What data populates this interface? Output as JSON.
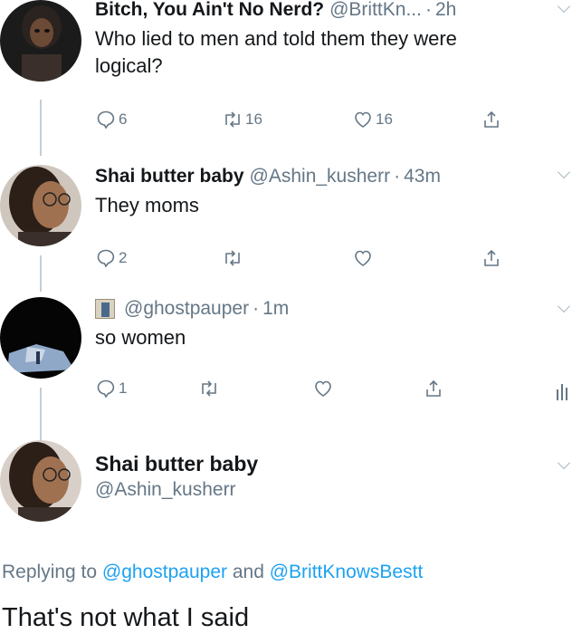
{
  "tweet1": {
    "name": "Bitch, You Ain't No Nerd?",
    "handle": "@BrittKn...",
    "sep": "·",
    "time": "2h",
    "text_line1": "Who lied to men and told them they were",
    "text_line2": "logical?",
    "replies": "6",
    "retweets": "16",
    "likes": "16"
  },
  "tweet2": {
    "name": "Shai butter baby",
    "handle": "@Ashin_kusherr",
    "sep": "·",
    "time": "43m",
    "text": "They moms",
    "replies": "2"
  },
  "tweet3": {
    "handle": "@ghostpauper",
    "sep": "·",
    "time": "1m",
    "text": "so women",
    "replies": "1"
  },
  "tweet4": {
    "name": "Shai butter baby",
    "handle": "@Ashin_kusherr",
    "replying_prefix": "Replying to",
    "reply_user1": "@ghostpauper",
    "reply_and": "and",
    "reply_user2": "@BrittKnowsBestt",
    "text": "That's not what I said"
  },
  "colors": {
    "text": "#14171a",
    "muted": "#657786",
    "link": "#1da1f2",
    "thread_line": "#c4cfd6"
  },
  "icons": [
    "reply-icon",
    "retweet-icon",
    "like-icon",
    "share-icon",
    "caret-down-icon",
    "stats-icon",
    "profile-emoji-icon"
  ]
}
